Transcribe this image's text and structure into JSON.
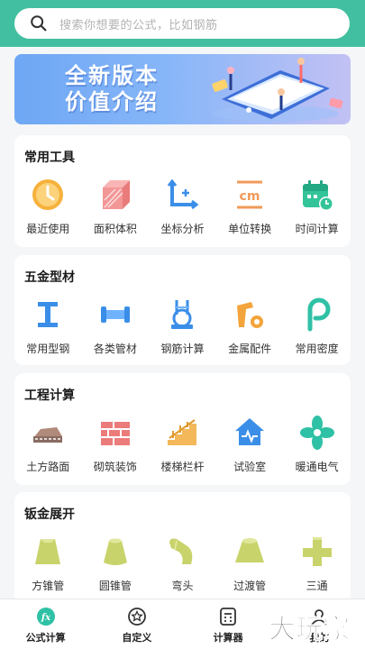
{
  "search": {
    "placeholder": "搜索你想要的公式，比如钢筋",
    "icon": "search-icon"
  },
  "banner": {
    "line1": "全新版本",
    "line2": "价值介绍"
  },
  "sections": [
    {
      "title": "常用工具",
      "items": [
        {
          "label": "最近使用",
          "icon": "clock-icon"
        },
        {
          "label": "面积体积",
          "icon": "cube-icon"
        },
        {
          "label": "坐标分析",
          "icon": "coordinate-icon"
        },
        {
          "label": "单位转换",
          "icon": "unit-cm-icon"
        },
        {
          "label": "时间计算",
          "icon": "calendar-icon"
        }
      ]
    },
    {
      "title": "五金型材",
      "items": [
        {
          "label": "常用型钢",
          "icon": "i-beam-icon"
        },
        {
          "label": "各类管材",
          "icon": "pipe-icon"
        },
        {
          "label": "钢筋计算",
          "icon": "rebar-icon"
        },
        {
          "label": "金属配件",
          "icon": "fitting-icon"
        },
        {
          "label": "常用密度",
          "icon": "density-icon"
        }
      ]
    },
    {
      "title": "工程计算",
      "items": [
        {
          "label": "土方路面",
          "icon": "road-icon"
        },
        {
          "label": "砌筑装饰",
          "icon": "brick-icon"
        },
        {
          "label": "楼梯栏杆",
          "icon": "stairs-icon"
        },
        {
          "label": "试验室",
          "icon": "lab-house-icon"
        },
        {
          "label": "暖通电气",
          "icon": "fan-icon"
        }
      ]
    },
    {
      "title": "钣金展开",
      "items": [
        {
          "label": "方锥管",
          "icon": "square-cone-icon"
        },
        {
          "label": "圆锥管",
          "icon": "round-cone-icon"
        },
        {
          "label": "弯头",
          "icon": "elbow-icon"
        },
        {
          "label": "过渡管",
          "icon": "transition-pipe-icon"
        },
        {
          "label": "三通",
          "icon": "tee-icon"
        }
      ]
    }
  ],
  "tabs": [
    {
      "label": "公式计算",
      "icon": "fx-icon",
      "active": true
    },
    {
      "label": "自定义",
      "icon": "star-badge-icon"
    },
    {
      "label": "计算器",
      "icon": "calculator-icon"
    },
    {
      "label": "我的",
      "icon": "user-icon"
    }
  ],
  "watermark": "大玩家",
  "colors": {
    "accent": "#42bfa0",
    "orange": "#f3a43b",
    "blue": "#3b8ee8",
    "green_icon": "#2fc1a5"
  }
}
